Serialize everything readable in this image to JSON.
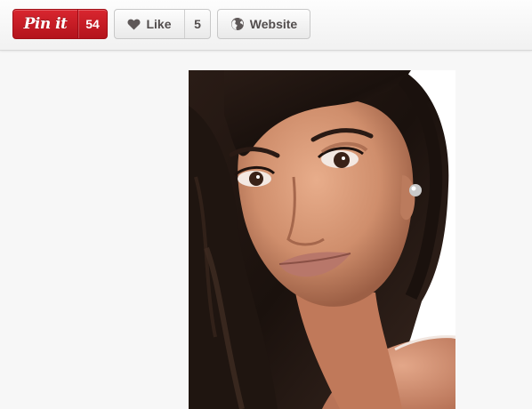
{
  "toolbar": {
    "pin": {
      "label": "Pin it",
      "count": "54"
    },
    "like": {
      "label": "Like",
      "count": "5",
      "icon": "heart-icon"
    },
    "website": {
      "label": "Website",
      "icon": "globe-icon"
    }
  },
  "colors": {
    "pin_red": "#c8202a",
    "button_text": "#524d4d",
    "background": "#f7f7f7"
  }
}
